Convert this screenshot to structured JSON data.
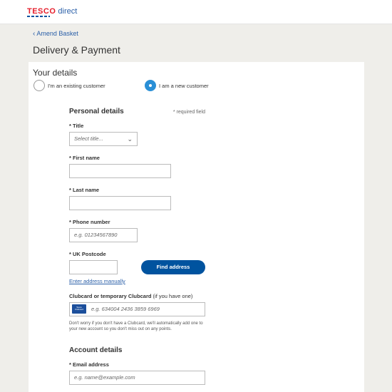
{
  "header": {
    "logo_brand": "TESCO",
    "logo_suffix": "direct"
  },
  "nav": {
    "back_label": "Amend Basket"
  },
  "page": {
    "title": "Delivery & Payment"
  },
  "your_details": {
    "title": "Your details",
    "existing_label": "I'm an existing customer",
    "new_label": "I am a new customer",
    "selected": "new"
  },
  "personal": {
    "title": "Personal details",
    "required_note": "* required field",
    "title_label": "* Title",
    "title_placeholder": "Select title...",
    "first_name_label": "* First name",
    "first_name_value": "",
    "last_name_label": "* Last name",
    "last_name_value": "",
    "phone_label": "* Phone number",
    "phone_placeholder": "e.g. 01234567890",
    "postcode_label": "* UK Postcode",
    "postcode_value": "",
    "find_address_label": "Find address",
    "enter_manually_label": "Enter address manually",
    "clubcard_label": "Clubcard or temporary Clubcard",
    "clubcard_label_suffix": "(if you have one)",
    "clubcard_icon_text": "Tesco Clubcard",
    "clubcard_placeholder": "e.g. 634004 2436 3859 6969",
    "clubcard_help": "Don't worry if you don't have a Clubcard, we'll automatically add one to your new account so you don't miss out on any points."
  },
  "account": {
    "title": "Account details",
    "email_label": "* Email address",
    "email_placeholder": "e.g. name@example.com"
  }
}
